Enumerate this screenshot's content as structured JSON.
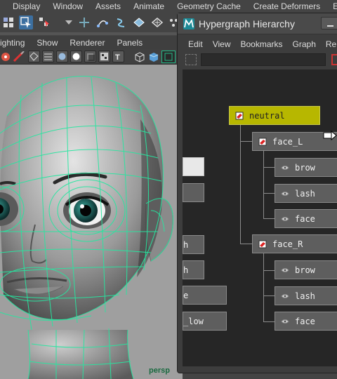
{
  "main_menu": [
    "Display",
    "Window",
    "Assets",
    "Animate",
    "Geometry Cache",
    "Create Deformers",
    "Edit Deformers"
  ],
  "panel_menu": [
    "ighting",
    "Show",
    "Renderer",
    "Panels"
  ],
  "viewport": {
    "camera_label": "persp"
  },
  "hypergraph": {
    "title": "Hypergraph Hierarchy",
    "menu": [
      "Edit",
      "View",
      "Bookmarks",
      "Graph",
      "Rende"
    ],
    "search_value": ""
  },
  "nodes": {
    "neutral": "neutral",
    "face_L": "face_L",
    "face_L_brow": "brow",
    "face_L_lash": "lash",
    "face_L_face": "face",
    "face_R": "face_R",
    "face_R_brow": "brow",
    "face_R_lash": "lash",
    "face_R_face": "face",
    "left_clipped": [
      "",
      "",
      "h",
      "h",
      "e",
      "_low"
    ]
  },
  "colors": {
    "selected_node": "#b7b700",
    "wireframe": "#27e6a0",
    "canvas": "#262626"
  }
}
